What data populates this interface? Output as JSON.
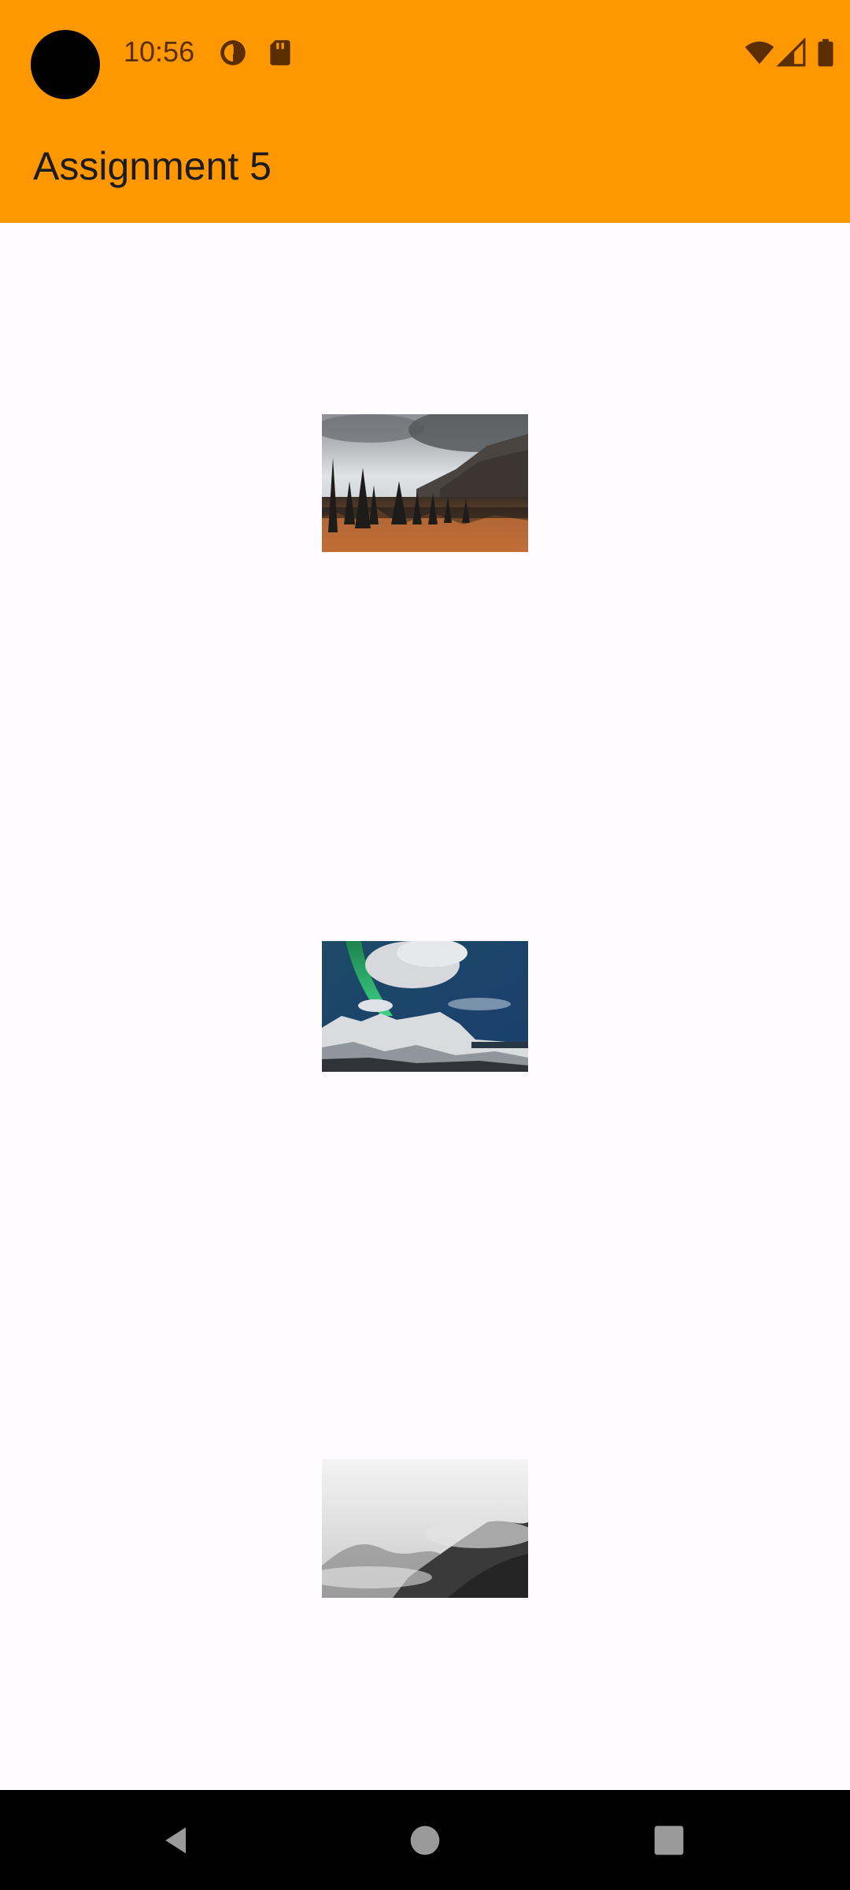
{
  "status_bar": {
    "time": "10:56",
    "left_icons": [
      "data-saver-icon",
      "sd-card-icon"
    ],
    "right_icons": [
      "wifi-icon",
      "cellular-signal-icon",
      "battery-icon"
    ]
  },
  "app_bar": {
    "title": "Assignment 5",
    "background_color": "#FF9800"
  },
  "images": [
    {
      "name": "forest-mountain-photo",
      "description_icon": "landscape-image"
    },
    {
      "name": "aurora-snow-photo",
      "description_icon": "landscape-image"
    },
    {
      "name": "foggy-mountain-photo",
      "description_icon": "landscape-image"
    }
  ],
  "nav_bar": {
    "buttons": [
      "back-icon",
      "home-icon",
      "recents-icon"
    ]
  },
  "colors": {
    "accent": "#FF9800",
    "background": "#FFFBFE",
    "status_text": "#5A2E00"
  }
}
